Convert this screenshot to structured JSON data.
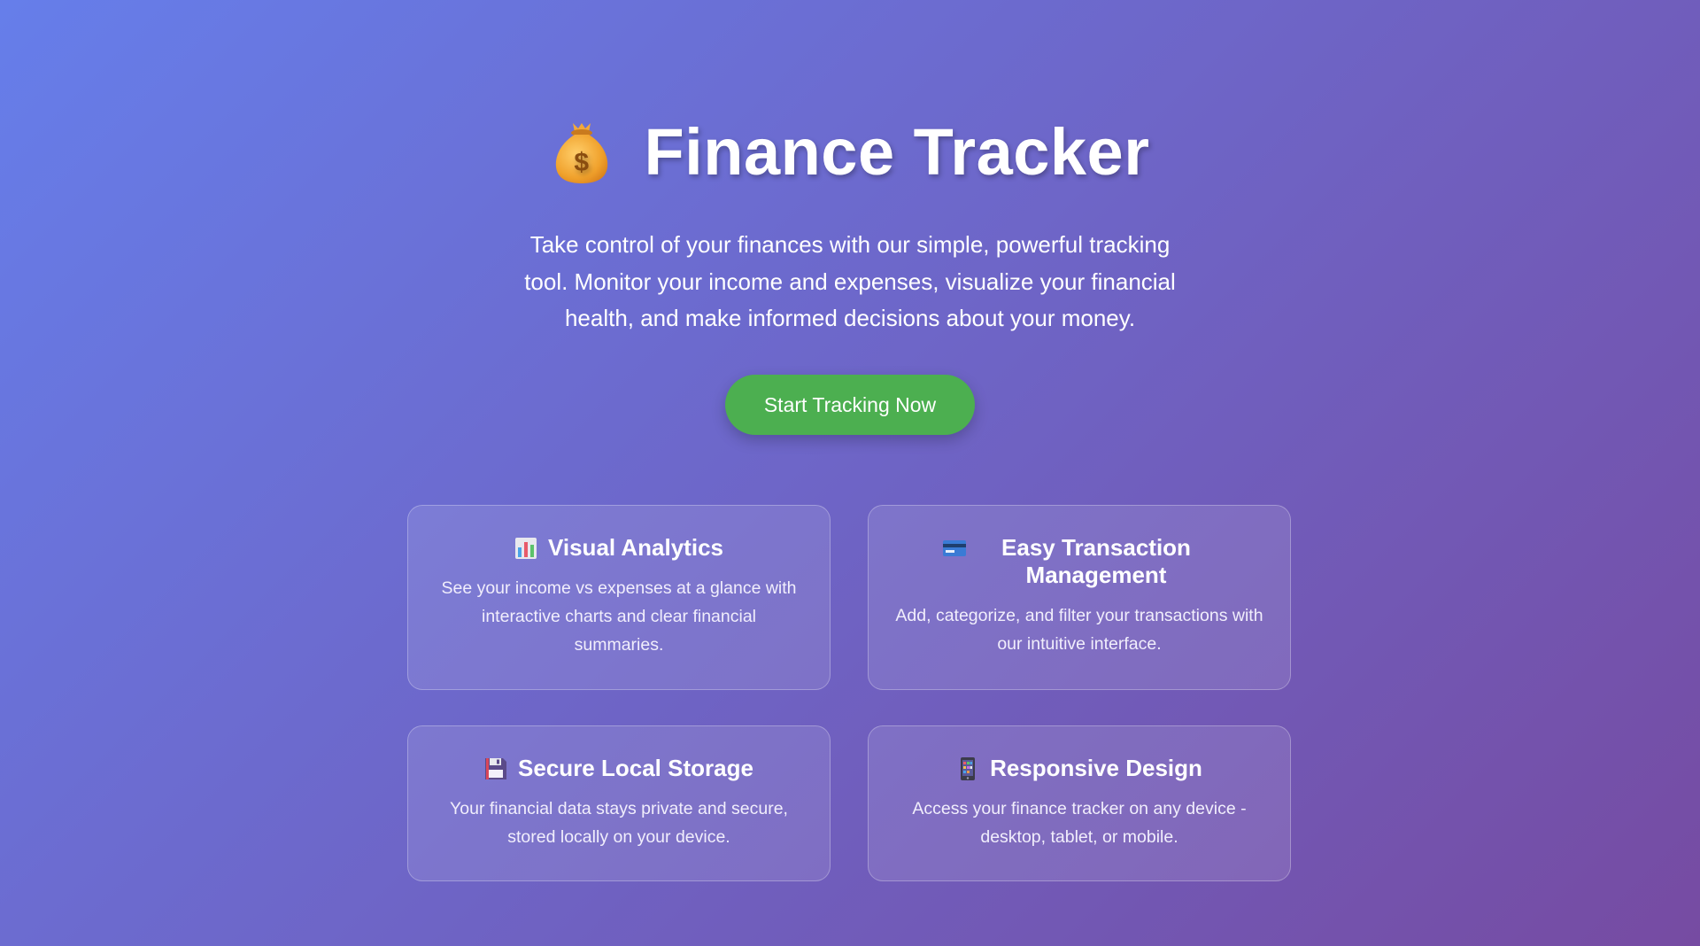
{
  "hero": {
    "title": "Finance Tracker",
    "title_icon": "money-bag-icon",
    "subtitle": "Take control of your finances with our simple, powerful tracking tool. Monitor your income and expenses, visualize your financial health, and make informed decisions about your money.",
    "cta_label": "Start Tracking Now"
  },
  "features": [
    {
      "icon": "bar-chart-icon",
      "title": "Visual Analytics",
      "description": "See your income vs expenses at a glance with interactive charts and clear financial summaries."
    },
    {
      "icon": "credit-card-icon",
      "title": "Easy Transaction Management",
      "description": "Add, categorize, and filter your transactions with our intuitive interface."
    },
    {
      "icon": "floppy-disk-icon",
      "title": "Secure Local Storage",
      "description": "Your financial data stays private and secure, stored locally on your device."
    },
    {
      "icon": "mobile-phone-icon",
      "title": "Responsive Design",
      "description": "Access your finance tracker on any device - desktop, tablet, or mobile."
    }
  ],
  "colors": {
    "background_start": "#667eea",
    "background_end": "#764ba2",
    "cta_background": "#4caf50",
    "text": "#ffffff"
  }
}
